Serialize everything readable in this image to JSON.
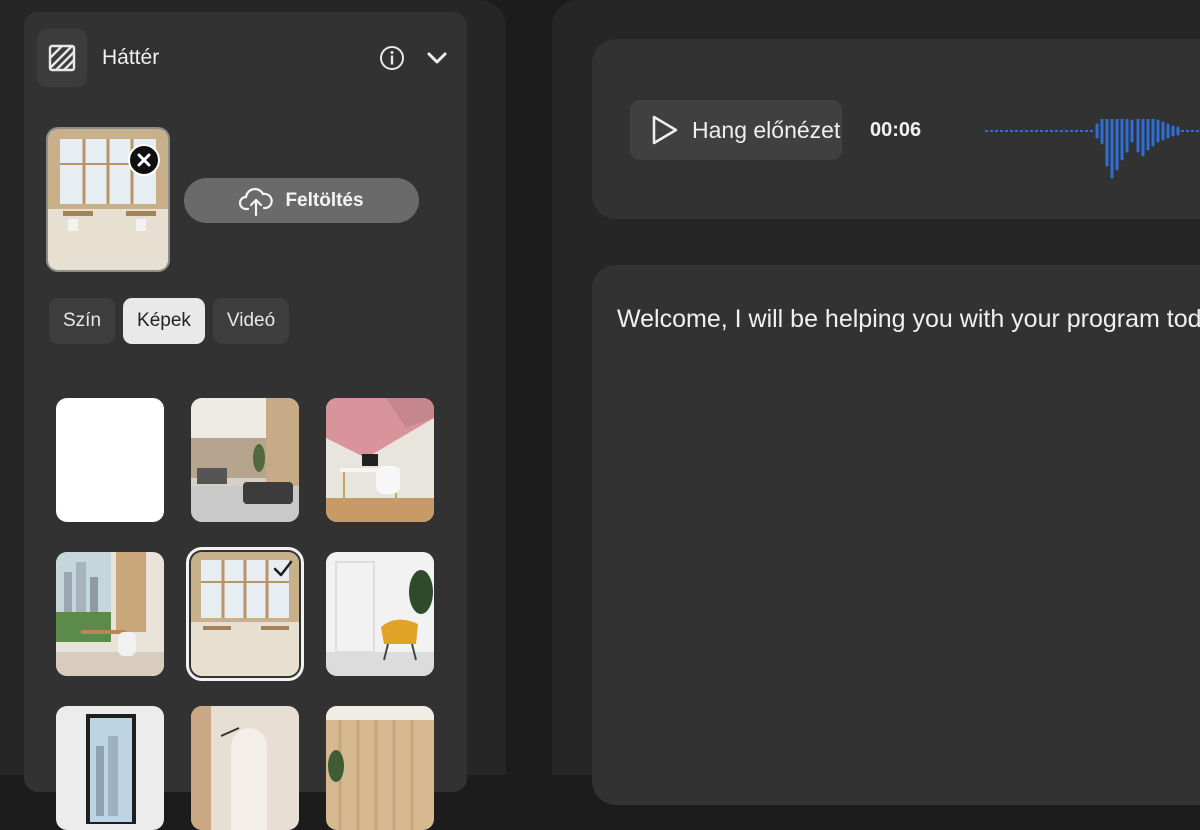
{
  "panel": {
    "title": "Háttér",
    "upload_label": "Feltöltés",
    "tabs": [
      {
        "label": "Szín",
        "active": false
      },
      {
        "label": "Képek",
        "active": true
      },
      {
        "label": "Videó",
        "active": false
      }
    ],
    "thumbnails": [
      {
        "name": "white",
        "selected": false
      },
      {
        "name": "office-lounge",
        "selected": false
      },
      {
        "name": "pink-desk",
        "selected": false
      },
      {
        "name": "city-office",
        "selected": false
      },
      {
        "name": "bright-office",
        "selected": true
      },
      {
        "name": "yellow-chair",
        "selected": false
      },
      {
        "name": "window-room",
        "selected": false
      },
      {
        "name": "arch-room",
        "selected": false
      },
      {
        "name": "wood-wall",
        "selected": false
      }
    ]
  },
  "audio": {
    "play_label": "Hang előnézet",
    "time": "00:06",
    "accent": "#2f6fd6"
  },
  "script": {
    "text": "Welcome, I will be helping you with your program today"
  }
}
